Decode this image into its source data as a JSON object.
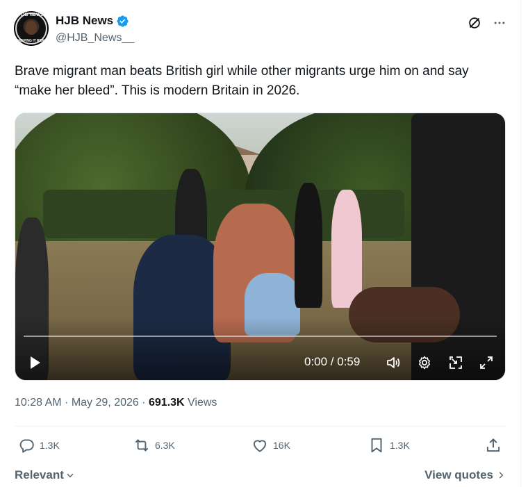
{
  "author": {
    "name": "HJB News",
    "handle": "@HJB_News__",
    "avatar_text_top": "HJB NEWS",
    "avatar_text_bottom": "KEEPING IT REAL",
    "verified_icon": "verified-badge-icon",
    "verified_color": "#1d9bf0"
  },
  "header_icons": [
    "grok-icon",
    "more-icon"
  ],
  "tweet": {
    "text": "Brave migrant man beats British girl while other migrants urge him on and say “make her bleed”. This is modern Britain in 2026."
  },
  "video": {
    "time": "0:00 / 0:59",
    "progress": 0,
    "controls": [
      "play-icon",
      "volume-icon",
      "settings-icon",
      "pip-icon",
      "fullscreen-icon"
    ]
  },
  "meta": {
    "time": "10:28 AM",
    "sep1": " · ",
    "date": "May 29, 2026",
    "sep2": " · ",
    "views_count": "691.3K",
    "views_label": " Views"
  },
  "actions": {
    "replies": "1.3K",
    "reposts": "6.3K",
    "likes": "16K",
    "bookmarks": "1.3K"
  },
  "footer": {
    "relevant": "Relevant",
    "view_quotes": "View quotes"
  },
  "colors": {
    "text": "#0f1419",
    "secondary": "#536471",
    "accent": "#1d9bf0"
  }
}
